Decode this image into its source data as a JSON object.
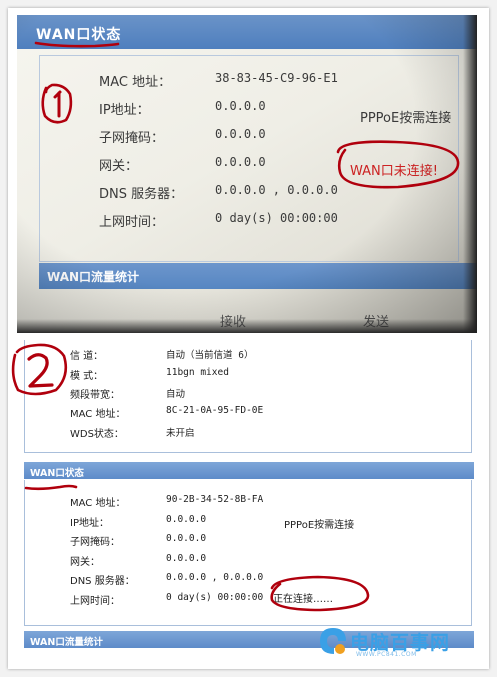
{
  "photo": {
    "header_title": "WAN口状态",
    "annotation_number": "1",
    "rows": [
      {
        "label": "MAC 地址：",
        "value": "38-83-45-C9-96-E1"
      },
      {
        "label": "IP地址：",
        "value": "0.0.0.0"
      },
      {
        "label": "子网掩码：",
        "value": "0.0.0.0"
      },
      {
        "label": "网关：",
        "value": "0.0.0.0"
      },
      {
        "label": "DNS 服务器：",
        "value": "0.0.0.0 , 0.0.0.0"
      },
      {
        "label": "上网时间：",
        "value": "0 day(s) 00:00:00"
      }
    ],
    "connection_type": "PPPoE按需连接",
    "warning": "WAN口未连接!",
    "stats_title": "WAN口流量统计",
    "col_receive": "接收",
    "col_send": "发送"
  },
  "shot": {
    "annotation_number": "2",
    "wireless_rows": [
      {
        "label": "信 道：",
        "value": "自动（当前信道 6）"
      },
      {
        "label": "模 式：",
        "value": "11bgn mixed"
      },
      {
        "label": "频段带宽：",
        "value": "自动"
      },
      {
        "label": "MAC 地址：",
        "value": "8C-21-0A-95-FD-0E"
      },
      {
        "label": "WDS状态：",
        "value": "未开启"
      }
    ],
    "wan_title": "WAN口状态",
    "wan_rows": [
      {
        "label": "MAC 地址：",
        "value": "90-2B-34-52-8B-FA"
      },
      {
        "label": "IP地址：",
        "value": "0.0.0.0"
      },
      {
        "label": "子网掩码：",
        "value": "0.0.0.0"
      },
      {
        "label": "网关：",
        "value": "0.0.0.0"
      },
      {
        "label": "DNS 服务器：",
        "value": "0.0.0.0 , 0.0.0.0"
      },
      {
        "label": "上网时间：",
        "value": "0 day(s) 00:00:00"
      }
    ],
    "connection_type": "PPPoE按需连接",
    "connecting": "正在连接……",
    "stats_title": "WAN口流量统计"
  },
  "watermark": {
    "text": "电脑百事网",
    "small": "WWW.PC841.COM",
    "icon": "pc841-logo-icon"
  },
  "colors": {
    "header_blue": "#5d8bc9",
    "annotation_red": "#b0000d",
    "warning_red": "#cc2222",
    "watermark_blue": "#3aa0e6"
  }
}
